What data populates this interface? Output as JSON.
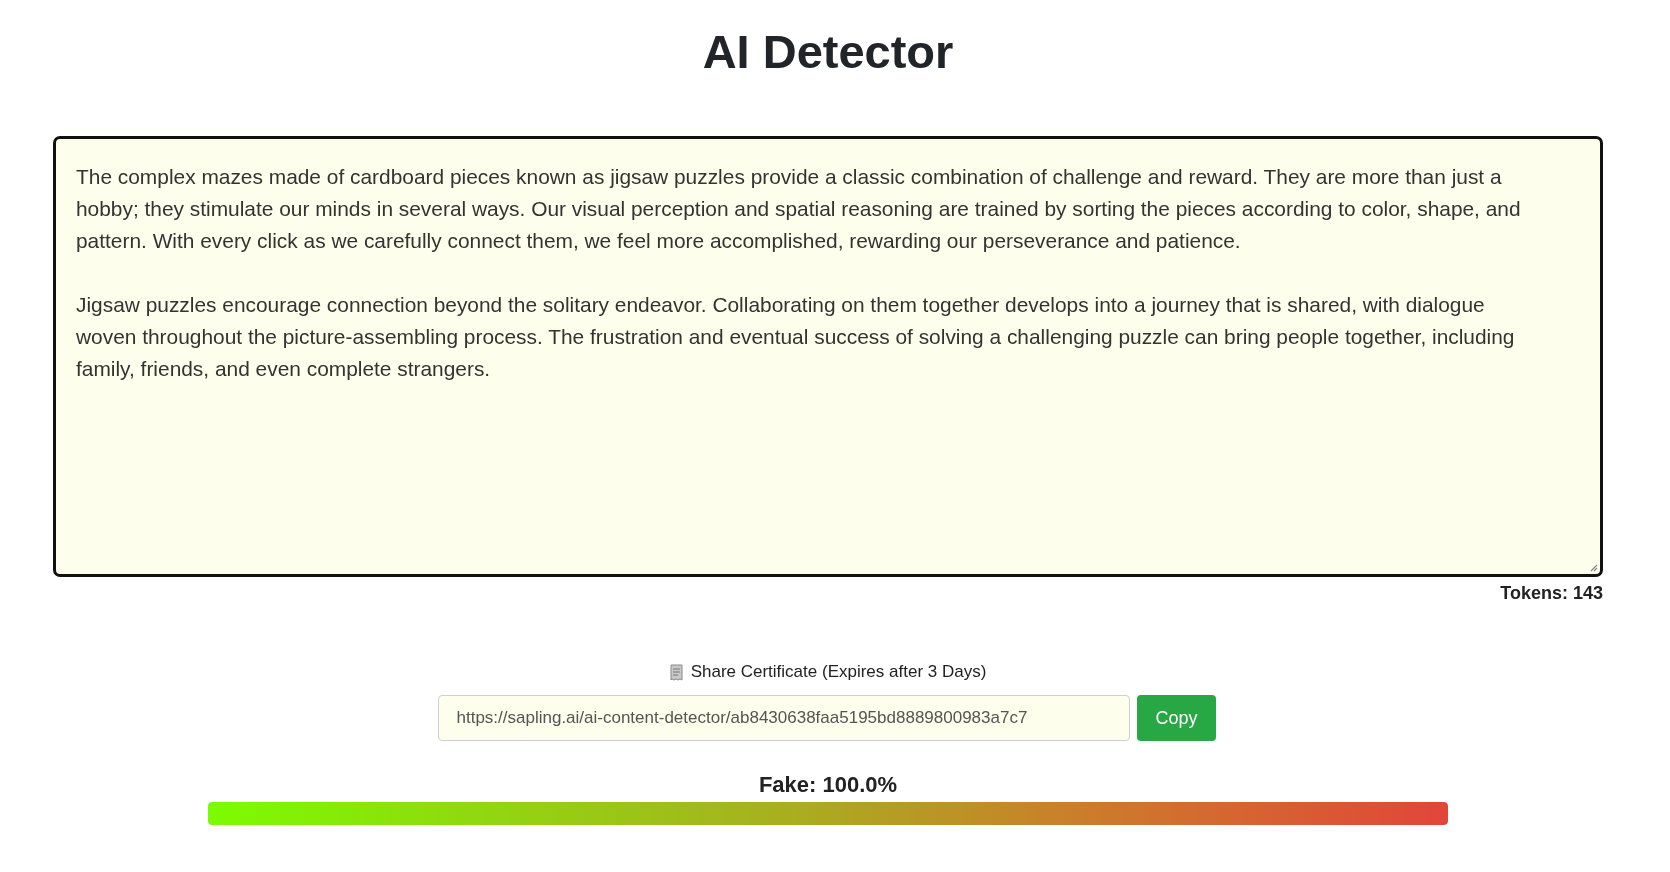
{
  "title": "AI Detector",
  "input": {
    "paragraphs": [
      "The complex mazes made of cardboard pieces known as jigsaw puzzles provide a classic combination of challenge and reward. They are more than just a hobby; they stimulate our minds in several ways. Our visual perception and spatial reasoning are trained by sorting the pieces according to color, shape, and pattern. With every click as we carefully connect them, we feel more accomplished, rewarding our perseverance and patience.",
      "Jigsaw puzzles encourage connection beyond the solitary endeavor. Collaborating on them together develops into a journey that is shared, with dialogue woven throughout the picture-assembling process. The frustration and eventual success of solving a challenging puzzle can bring people together, including family, friends, and even complete strangers."
    ]
  },
  "tokens": "Tokens: 143",
  "share": {
    "label": "Share Certificate (Expires after 3 Days)",
    "url": "https://sapling.ai/ai-content-detector/ab8430638faa5195bd8889800983a7c7",
    "button": "Copy"
  },
  "result": {
    "label": "Fake: 100.0%",
    "level": 1.0
  }
}
